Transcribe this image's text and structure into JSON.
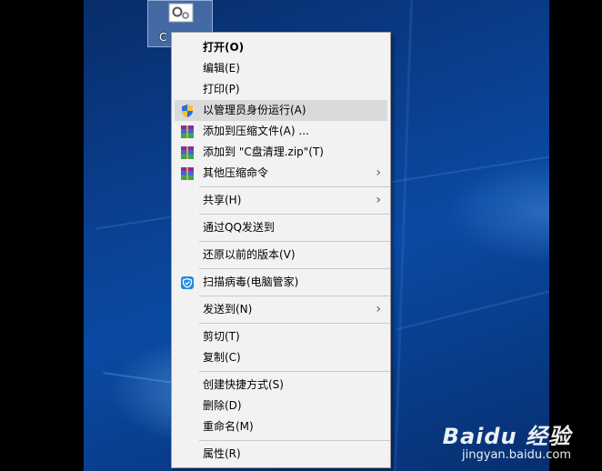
{
  "desktop_icon": {
    "label": "C"
  },
  "menu": {
    "items": [
      {
        "label": "打开(O)",
        "bold": true
      },
      {
        "label": "编辑(E)"
      },
      {
        "label": "打印(P)"
      },
      {
        "label": "以管理员身份运行(A)",
        "icon": "shield-icon"
      },
      {
        "label": "添加到压缩文件(A) ...",
        "icon": "winrar-icon"
      },
      {
        "label": "添加到 \"C盘清理.zip\"(T)",
        "icon": "winrar-icon"
      },
      {
        "label": "其他压缩命令",
        "icon": "winrar-icon",
        "submenu": true
      },
      {
        "label": "共享(H)",
        "submenu": true
      },
      {
        "label": "通过QQ发送到"
      },
      {
        "label": "还原以前的版本(V)"
      },
      {
        "label": "扫描病毒(电脑管家)",
        "icon": "tencent-pc-manager-icon"
      },
      {
        "label": "发送到(N)",
        "submenu": true
      },
      {
        "label": "剪切(T)"
      },
      {
        "label": "复制(C)"
      },
      {
        "label": "创建快捷方式(S)"
      },
      {
        "label": "删除(D)"
      },
      {
        "label": "重命名(M)"
      },
      {
        "label": "属性(R)"
      }
    ],
    "submenu_arrow": "›"
  },
  "watermark": {
    "brand": "Baidu 经验",
    "site": "jingyan.baidu.com"
  },
  "colors": {
    "menu_bg": "#f2f2f2",
    "highlight": "#dadada",
    "desktop": "#0b3f8f"
  }
}
